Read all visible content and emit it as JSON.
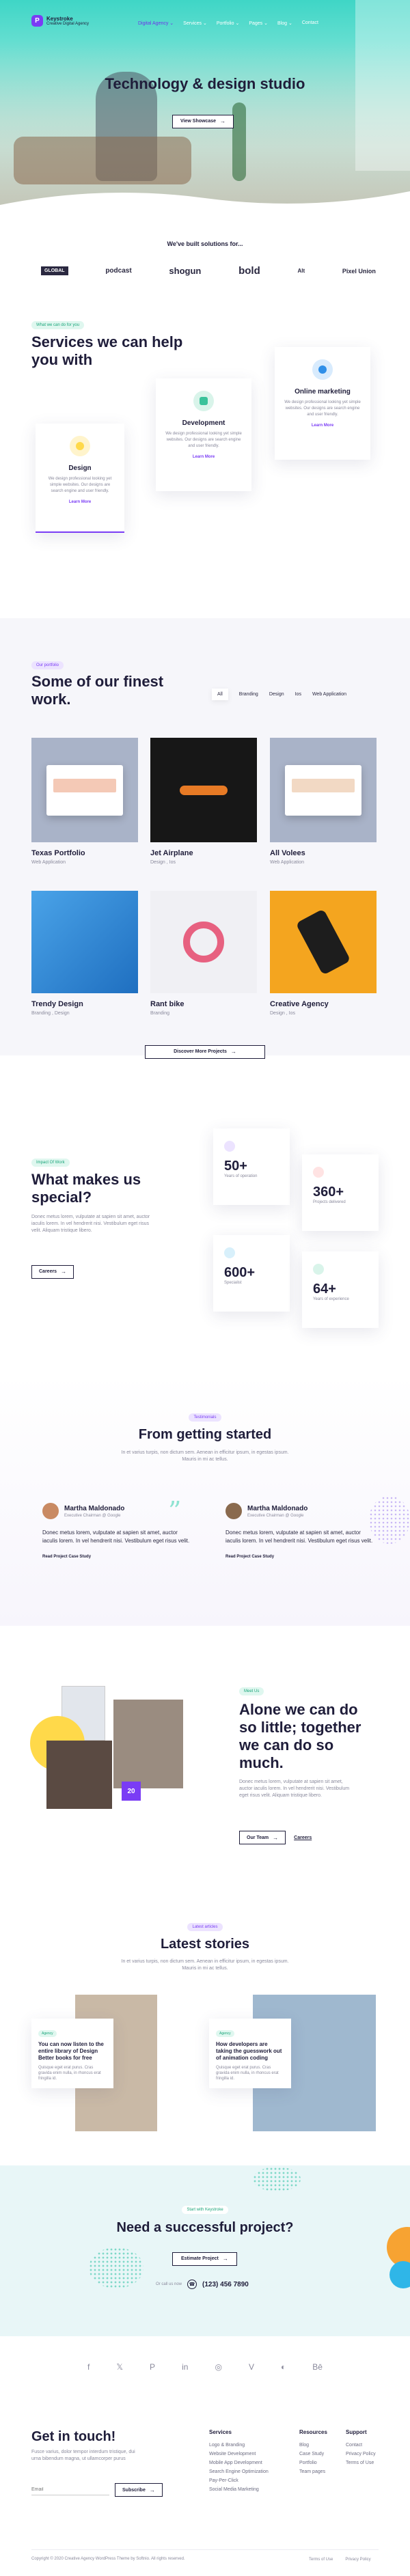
{
  "header": {
    "brand_name": "Keystroke",
    "brand_tagline": "Creative Digital Agency",
    "nav": [
      "Digital Agency ⌄",
      "Services ⌄",
      "Portfolio ⌄",
      "Pages ⌄",
      "Blog ⌄",
      "Contact"
    ]
  },
  "hero": {
    "title": "Technology & design studio",
    "button": "View Showcase"
  },
  "clients": {
    "heading": "We've built solutions for...",
    "logos": [
      "GLOBAL",
      "podcast",
      "shogun",
      "bold",
      "Alt",
      "Pixel Union"
    ]
  },
  "services": {
    "tag": "What we can do for you",
    "title": "Services we can help you with",
    "cards": [
      {
        "title": "Design",
        "text": "We design professional looking yet simple websites. Our designs are search engine and user friendly.",
        "link": "Learn More",
        "color": "#ffd94a"
      },
      {
        "title": "Development",
        "text": "We design professional looking yet simple websites. Our designs are search engine and user friendly.",
        "link": "Learn More",
        "color": "#3ac29a"
      },
      {
        "title": "Online marketing",
        "text": "We design professional looking yet simple websites. Our designs are search engine and user friendly.",
        "link": "Learn More",
        "color": "#2f8fe8"
      }
    ]
  },
  "work": {
    "tag": "Our portfolio",
    "title": "Some of our finest work.",
    "filters": [
      "All",
      "Branding",
      "Design",
      "Ios",
      "Web Application"
    ],
    "projects": [
      {
        "title": "Texas Portfolio",
        "sub": "Web Application"
      },
      {
        "title": "Jet Airplane",
        "sub": "Design , Ios"
      },
      {
        "title": "All Volees",
        "sub": "Web Application"
      },
      {
        "title": "Trendy Design",
        "sub": "Branding , Design"
      },
      {
        "title": "Rant bike",
        "sub": "Branding"
      },
      {
        "title": "Creative Agency",
        "sub": "Design , Ios"
      }
    ],
    "button": "Discover More Projects"
  },
  "special": {
    "tag": "Impact Of Work",
    "title": "What makes us special?",
    "text": "Donec metus lorem, vulputate at sapien sit amet, auctor iaculis lorem. In vel hendrerit nisi. Vestibulum eget risus velit. Aliquam tristique libero.",
    "button": "Careers",
    "stats": [
      {
        "num": "50+",
        "label": "Years of operation"
      },
      {
        "num": "360+",
        "label": "Projects delivered"
      },
      {
        "num": "600+",
        "label": "Specialist"
      },
      {
        "num": "64+",
        "label": "Years of experience"
      }
    ]
  },
  "testimonials": {
    "tag": "Testimonials",
    "title": "From getting started",
    "subtitle": "In et varius turpis, non dictum sem. Aenean in efficitur ipsum, in egestas ipsum. Mauris in mi ac tellus.",
    "items": [
      {
        "name": "Martha Maldonado",
        "role": "Executive Chairman @ Google",
        "text": "Donec metus lorem, vulputate at sapien sit amet, auctor iaculis lorem. In vel hendrerit nisi. Vestibulum eget risus velit.",
        "link": "Read Project Case Study"
      },
      {
        "name": "Martha Maldonado",
        "role": "Executive Chairman @ Google",
        "text": "Donec metus lorem, vulputate at sapien sit amet, auctor iaculis lorem. In vel hendrerit nisi. Vestibulum eget risus velit.",
        "link": "Read Project Case Study"
      }
    ]
  },
  "team": {
    "tag": "Meet Us",
    "title": "Alone we can do so little; together we can do so much.",
    "text": "Donec metus lorem, vulputate at sapien sit amet, auctor iaculis lorem. In vel hendrerit nisi. Vestibulum eget risus velit. Aliquam tristique libero.",
    "badge": "20",
    "button": "Our Team",
    "link": "Careers"
  },
  "stories": {
    "tag": "Latest articles",
    "title": "Latest stories",
    "subtitle": "In et varius turpis, non dictum sem. Aenean in efficitur ipsum, in egestas ipsum. Mauris in mi ac tellus.",
    "posts": [
      {
        "cat": "Agency",
        "title": "You can now listen to the entire library of Design Better books for free",
        "text": "Quisque eget erat purus. Cras gravida enim nulla, in rhoncus erat fringilla id."
      },
      {
        "cat": "Agency",
        "title": "How developers are taking the guesswork out of animation coding",
        "text": "Quisque eget erat purus. Cras gravida enim nulla, in rhoncus erat fringilla id."
      }
    ]
  },
  "cta": {
    "tag": "Start with Keystroke",
    "title": "Need a successful project?",
    "button": "Estimate Project",
    "or": "Or call us now",
    "phone": "(123) 456 7890"
  },
  "footer": {
    "social": [
      "f",
      "𝕏",
      "P",
      "in",
      "◎",
      "V",
      "◐",
      "Bē"
    ],
    "contact_title": "Get in touch!",
    "contact_text": "Fusce varius, dolor tempor interdum tristique, dui urna bibendum magna, ut ullamcorper purus",
    "email_placeholder": "Email",
    "subscribe": "Subscribe",
    "cols": [
      {
        "title": "Services",
        "links": [
          "Logo & Branding",
          "Website Development",
          "Mobile App Development",
          "Search Engine Optimization",
          "Pay-Per-Click",
          "Social Media Marketing"
        ]
      },
      {
        "title": "Resources",
        "links": [
          "Blog",
          "Case Study",
          "Portfolio",
          "Team pages"
        ]
      },
      {
        "title": "Support",
        "links": [
          "Contact",
          "Privacy Policy",
          "Terms of Use"
        ]
      }
    ],
    "copyright": "Copyright © 2020 Creative Agency WordPress Theme by Softnio. All rights reserved.",
    "terms": "Terms of Use",
    "privacy": "Privacy Policy"
  },
  "colors": {
    "primary": "#7a3cf5",
    "dark": "#1f1d3a",
    "teal": "#7fe6d6",
    "accent_orange": "#f7a332",
    "cta_bg": "#e8f6f7"
  }
}
